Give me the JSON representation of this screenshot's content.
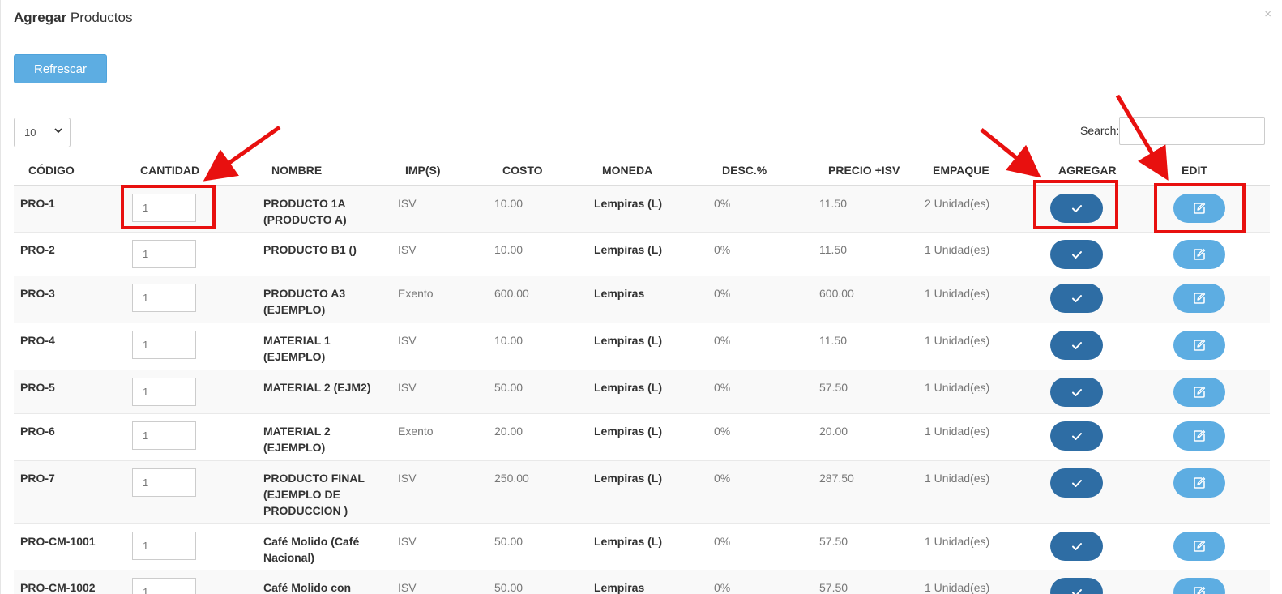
{
  "modal": {
    "title_bold": "Agregar",
    "title_rest": "Productos",
    "close": "×"
  },
  "toolbar": {
    "refresh_label": "Refrescar"
  },
  "table_controls": {
    "page_length": "10",
    "page_length_options": [
      "10"
    ],
    "search_label": "Search:",
    "search_value": ""
  },
  "table": {
    "headers": {
      "codigo": "CÓDIGO",
      "cantidad": "CANTIDAD",
      "nombre": "NOMBRE",
      "imps": "IMP(S)",
      "costo": "COSTO",
      "moneda": "MONEDA",
      "desc": "DESC.%",
      "precio": "PRECIO +ISV",
      "empaque": "EMPAQUE",
      "agregar": "AGREGAR",
      "edit": "EDIT"
    },
    "rows": [
      {
        "codigo": "PRO-1",
        "cantidad": "1",
        "nombre": "PRODUCTO 1A (PRODUCTO A)",
        "imps": "ISV",
        "costo": "10.00",
        "moneda": "Lempiras (L)",
        "desc": "0%",
        "precio": "11.50",
        "empaque": "2 Unidad(es)"
      },
      {
        "codigo": "PRO-2",
        "cantidad": "1",
        "nombre": "PRODUCTO B1 ()",
        "imps": "ISV",
        "costo": "10.00",
        "moneda": "Lempiras (L)",
        "desc": "0%",
        "precio": "11.50",
        "empaque": "1 Unidad(es)"
      },
      {
        "codigo": "PRO-3",
        "cantidad": "1",
        "nombre": "PRODUCTO A3 (EJEMPLO)",
        "imps": "Exento",
        "costo": "600.00",
        "moneda": "Lempiras",
        "desc": "0%",
        "precio": "600.00",
        "empaque": "1 Unidad(es)"
      },
      {
        "codigo": "PRO-4",
        "cantidad": "1",
        "nombre": "MATERIAL 1 (EJEMPLO)",
        "imps": "ISV",
        "costo": "10.00",
        "moneda": "Lempiras (L)",
        "desc": "0%",
        "precio": "11.50",
        "empaque": "1 Unidad(es)"
      },
      {
        "codigo": "PRO-5",
        "cantidad": "1",
        "nombre": "MATERIAL 2 (EJM2)",
        "imps": "ISV",
        "costo": "50.00",
        "moneda": "Lempiras (L)",
        "desc": "0%",
        "precio": "57.50",
        "empaque": "1 Unidad(es)"
      },
      {
        "codigo": "PRO-6",
        "cantidad": "1",
        "nombre": "MATERIAL 2 (EJEMPLO)",
        "imps": "Exento",
        "costo": "20.00",
        "moneda": "Lempiras (L)",
        "desc": "0%",
        "precio": "20.00",
        "empaque": "1 Unidad(es)"
      },
      {
        "codigo": "PRO-7",
        "cantidad": "1",
        "nombre": "PRODUCTO FINAL (EJEMPLO DE PRODUCCION )",
        "imps": "ISV",
        "costo": "250.00",
        "moneda": "Lempiras (L)",
        "desc": "0%",
        "precio": "287.50",
        "empaque": "1 Unidad(es)"
      },
      {
        "codigo": "PRO-CM-1001",
        "cantidad": "1",
        "nombre": "Café Molido (Café Nacional)",
        "imps": "ISV",
        "costo": "50.00",
        "moneda": "Lempiras (L)",
        "desc": "0%",
        "precio": "57.50",
        "empaque": "1 Unidad(es)"
      },
      {
        "codigo": "PRO-CM-1002",
        "cantidad": "1",
        "nombre": "Café Molido con",
        "imps": "ISV",
        "costo": "50.00",
        "moneda": "Lempiras",
        "desc": "0%",
        "precio": "57.50",
        "empaque": "1 Unidad(es)"
      }
    ]
  },
  "colors": {
    "primary": "#2e6da4",
    "info": "#5dade2",
    "annotation": "#e8100f"
  },
  "icons": {
    "agregar": "check-icon",
    "edit": "edit-icon"
  }
}
